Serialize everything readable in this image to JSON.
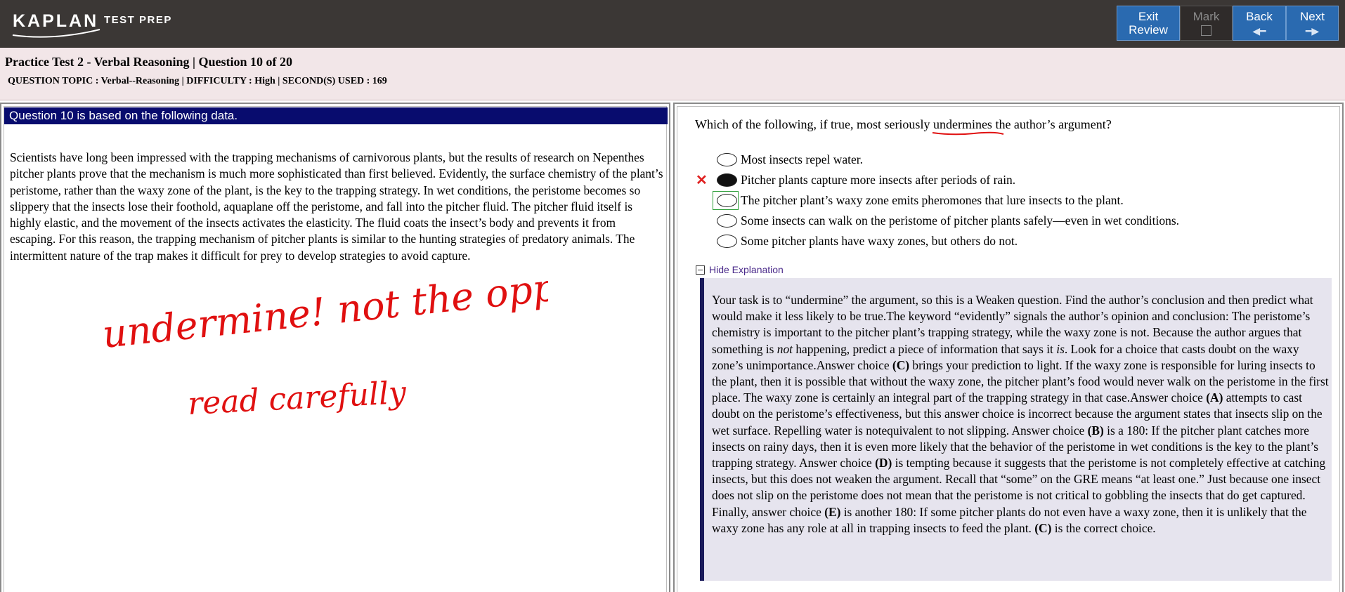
{
  "topbar": {
    "logo_main": "KAPLAN",
    "logo_sub": "TEST PREP",
    "buttons": {
      "exit_line1": "Exit",
      "exit_line2": "Review",
      "mark": "Mark",
      "back": "Back",
      "next": "Next"
    }
  },
  "info": {
    "title": "Practice Test 2 - Verbal Reasoning | Question  10 of 20",
    "meta": "QUESTION TOPIC : Verbal--Reasoning | DIFFICULTY : High | SECOND(S) USED : 169"
  },
  "passage": {
    "header": "Question 10 is based on the following data.",
    "text": "Scientists have long been impressed with the trapping mechanisms of carnivorous plants, but the results of research on Nepenthes pitcher plants prove that the mechanism is much more sophisticated than first believed. Evidently, the surface chemistry of the plant’s peristome, rather than the waxy zone of the plant, is the key to the trapping strategy. In wet conditions, the peristome becomes so slippery that the insects lose their foothold, aquaplane off the peristome, and fall into the pitcher fluid. The pitcher fluid itself is highly elastic, and the movement of the insects activates the elasticity. The fluid coats the insect’s body and prevents it from escaping. For this reason, the trapping mechanism of pitcher plants is similar to the hunting strategies of predatory animals. The intermittent nature of the trap makes it difficult for prey to develop strategies to avoid capture.",
    "annotation_line1": "undermine! not the opposite",
    "annotation_line2": "read carefully"
  },
  "question": {
    "before": "Which of the following, if true, most seriously ",
    "emphasis": "undermines",
    "after": " the author’s argument?",
    "selected_index": 1,
    "correct_index": 2,
    "choices": [
      "Most insects repel water.",
      "Pitcher plants capture more insects after periods of rain.",
      "The pitcher plant’s waxy zone emits pheromones that lure insects to the plant.",
      "Some insects can walk on the peristome of pitcher plants safely—even in wet conditions.",
      "Some pitcher plants have waxy zones, but others do not."
    ],
    "wrong_marker": "✕"
  },
  "explanation": {
    "toggle_label": "Hide Explanation",
    "p1": "Your task is to “undermine” the argument, so this is a Weaken question. Find the author’s conclusion and then predict what would make it less likely to be true.The keyword “evidently” signals the author’s opinion and conclusion: The peristome’s chemistry is important to the pitcher plant’s trapping strategy, while the waxy zone is not. Because the author argues that something is ",
    "not": "not",
    "p2": " happening, predict a piece of information that says it ",
    "is": "is",
    "p3": ". Look for a choice that casts doubt on the waxy zone’s unimportance.Answer choice ",
    "c1": "(C)",
    "p4": " brings your prediction to light. If the waxy zone is responsible for luring insects to the plant, then it is possible that without the waxy zone, the pitcher plant’s food would never walk on the peristome in the first place. The waxy zone is certainly an integral part of the trapping strategy in that case.Answer choice ",
    "a": "(A)",
    "p5": " attempts to cast doubt on the peristome’s effectiveness, but this answer choice is incorrect because the argument states that insects slip on the wet surface. Repelling water is notequivalent to not slipping. Answer choice ",
    "b": "(B)",
    "p6": " is a 180: If the pitcher plant catches more insects on rainy days, then it is even more likely that the behavior of the peristome in wet conditions is the key to the plant’s trapping strategy. Answer choice ",
    "d": "(D)",
    "p7": " is tempting because it suggests that the peristome is not completely effective at catching insects, but this does not weaken the argument. Recall that “some” on the GRE means “at least one.” Just because one insect does not slip on the peristome does not mean that the peristome is not critical to gobbling the insects that do get captured. Finally, answer choice ",
    "e": "(E)",
    "p8": " is another 180: If some pitcher plants do not even have a waxy zone, then it is unlikely that the waxy zone has any role at all in trapping insects to feed the plant. ",
    "c2": "(C)",
    "p9": " is the correct choice."
  },
  "colors": {
    "topbar": "#3b3735",
    "button": "#2a6ab0",
    "infobar": "#f2e6e8",
    "passage_header": "#080c6e",
    "explanation_bg": "#e6e4ee",
    "ink_red": "#e01010"
  }
}
